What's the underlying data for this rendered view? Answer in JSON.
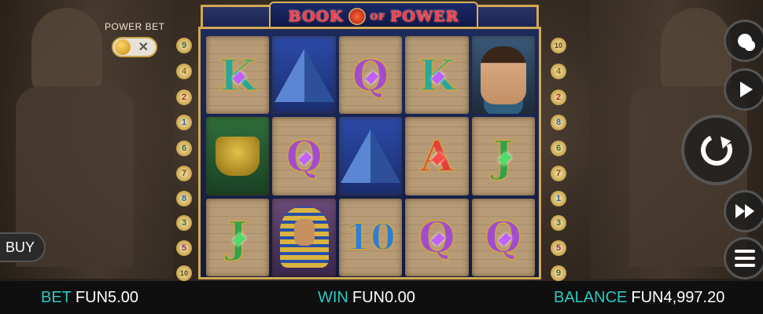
{
  "game": {
    "logo_left": "BOOK",
    "logo_mid": "OF",
    "logo_right": "POWER"
  },
  "power_bet": {
    "label": "POWER BET",
    "off_glyph": "✕",
    "state": "off"
  },
  "buy_button": {
    "label": "BUY"
  },
  "paylines": {
    "left": [
      "9",
      "4",
      "2",
      "1",
      "6",
      "7",
      "8",
      "3",
      "5",
      "10"
    ],
    "right": [
      "10",
      "4",
      "2",
      "8",
      "6",
      "7",
      "1",
      "3",
      "5",
      "9"
    ]
  },
  "reels": [
    [
      {
        "symbol": "K",
        "type": "k"
      },
      {
        "symbol": "",
        "type": "urn"
      },
      {
        "symbol": "J",
        "type": "j"
      }
    ],
    [
      {
        "symbol": "",
        "type": "pyramid"
      },
      {
        "symbol": "Q",
        "type": "q"
      },
      {
        "symbol": "",
        "type": "pharaoh"
      }
    ],
    [
      {
        "symbol": "Q",
        "type": "q"
      },
      {
        "symbol": "",
        "type": "pyramid"
      },
      {
        "symbol": "10",
        "type": "ten"
      }
    ],
    [
      {
        "symbol": "K",
        "type": "k"
      },
      {
        "symbol": "A",
        "type": "a"
      },
      {
        "symbol": "Q",
        "type": "q"
      }
    ],
    [
      {
        "symbol": "",
        "type": "explorer"
      },
      {
        "symbol": "J",
        "type": "j"
      },
      {
        "symbol": "Q",
        "type": "q"
      }
    ]
  ],
  "controls": {
    "coins_icon": "coins-icon",
    "autoplay_icon": "play-icon",
    "spin_icon": "spin-icon",
    "turbo_icon": "fast-forward-icon",
    "menu_icon": "hamburger-menu-icon"
  },
  "bottom_bar": {
    "bet_label": "BET",
    "bet_value": "FUN5.00",
    "win_label": "WIN",
    "win_value": "FUN0.00",
    "balance_label": "BALANCE",
    "balance_value": "FUN4,997.20"
  },
  "colors": {
    "accent_teal": "#2fc7c0",
    "frame_gold": "#d2a952",
    "logo_red": "#ff3d48"
  }
}
